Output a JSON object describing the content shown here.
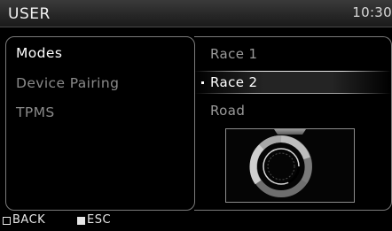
{
  "header": {
    "title": "USER",
    "clock": "10:30"
  },
  "menu": {
    "items": [
      {
        "label": "Modes",
        "state": "active"
      },
      {
        "label": "Device Pairing",
        "state": "inactive"
      },
      {
        "label": "TPMS",
        "state": "inactive"
      }
    ]
  },
  "submenu": {
    "items": [
      {
        "label": "Race 1"
      },
      {
        "label": "Race 2",
        "selected": true
      },
      {
        "label": "Road"
      }
    ]
  },
  "preview": {
    "icon": "gauge-icon"
  },
  "footer": {
    "back_label": "BACK",
    "esc_label": "ESC"
  },
  "colors": {
    "background": "#000000",
    "header": "#2a2a2a",
    "text_active": "#ffffff",
    "text_inactive": "#8a8a8a",
    "border": "#7b7b7b"
  }
}
